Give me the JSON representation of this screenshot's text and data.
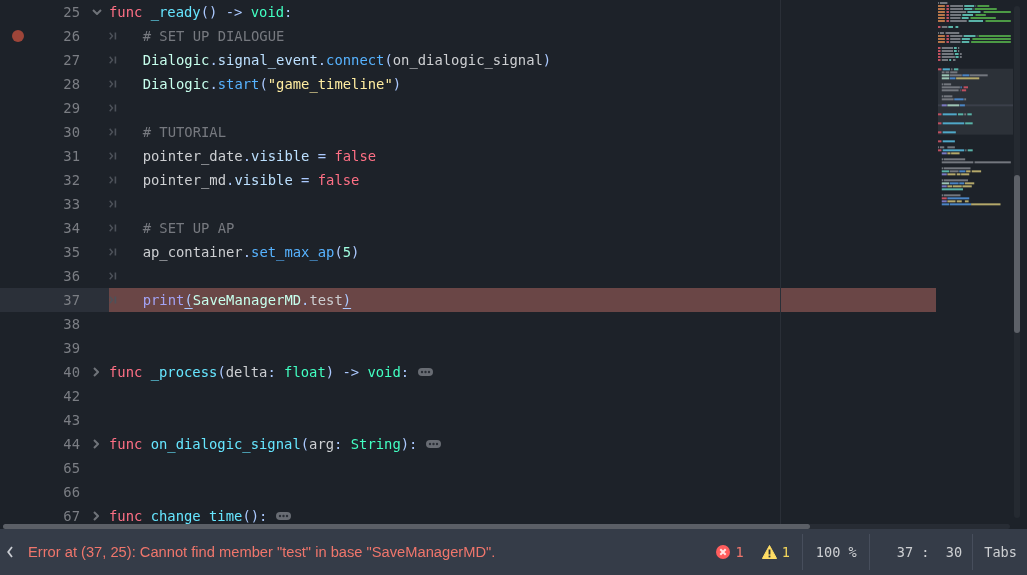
{
  "editor": {
    "lines": [
      {
        "number": "25",
        "folded": false,
        "breakpoint": false,
        "indented": false,
        "current": false,
        "error_highlight": false,
        "tokens": [
          {
            "kind": "keyword",
            "text": "func "
          },
          {
            "kind": "function_def",
            "text": "_ready"
          },
          {
            "kind": "symbol",
            "text": "() -> "
          },
          {
            "kind": "base_type",
            "text": "void"
          },
          {
            "kind": "symbol",
            "text": ":"
          }
        ]
      },
      {
        "number": "26",
        "breakpoint": true,
        "indented": true,
        "current": false,
        "error_highlight": false,
        "tokens": [
          {
            "kind": "comment",
            "text": "# SET UP DIALOGUE"
          }
        ]
      },
      {
        "number": "27",
        "breakpoint": false,
        "indented": true,
        "current": false,
        "error_highlight": false,
        "tokens": [
          {
            "kind": "user_type",
            "text": "Dialogic"
          },
          {
            "kind": "symbol",
            "text": "."
          },
          {
            "kind": "member",
            "text": "signal_event"
          },
          {
            "kind": "symbol",
            "text": "."
          },
          {
            "kind": "function",
            "text": "connect"
          },
          {
            "kind": "symbol",
            "text": "("
          },
          {
            "kind": "text",
            "text": "on_dialogic_signal"
          },
          {
            "kind": "symbol",
            "text": ")"
          }
        ]
      },
      {
        "number": "28",
        "breakpoint": false,
        "indented": true,
        "current": false,
        "error_highlight": false,
        "tokens": [
          {
            "kind": "user_type",
            "text": "Dialogic"
          },
          {
            "kind": "symbol",
            "text": "."
          },
          {
            "kind": "function",
            "text": "start"
          },
          {
            "kind": "symbol",
            "text": "("
          },
          {
            "kind": "string",
            "text": "\"game_timeline\""
          },
          {
            "kind": "symbol",
            "text": ")"
          }
        ]
      },
      {
        "number": "29",
        "breakpoint": false,
        "indented": true,
        "current": false,
        "error_highlight": false
      },
      {
        "number": "30",
        "breakpoint": false,
        "indented": true,
        "current": false,
        "error_highlight": false,
        "tokens": [
          {
            "kind": "comment",
            "text": "# TUTORIAL"
          }
        ]
      },
      {
        "number": "31",
        "breakpoint": false,
        "indented": true,
        "current": false,
        "error_highlight": false,
        "tokens": [
          {
            "kind": "text",
            "text": "pointer_date"
          },
          {
            "kind": "symbol",
            "text": "."
          },
          {
            "kind": "member",
            "text": "visible"
          },
          {
            "kind": "symbol",
            "text": " = "
          },
          {
            "kind": "keyword",
            "text": "false"
          }
        ]
      },
      {
        "number": "32",
        "breakpoint": false,
        "indented": true,
        "current": false,
        "error_highlight": false,
        "tokens": [
          {
            "kind": "text",
            "text": "pointer_md"
          },
          {
            "kind": "symbol",
            "text": "."
          },
          {
            "kind": "member",
            "text": "visible"
          },
          {
            "kind": "symbol",
            "text": " = "
          },
          {
            "kind": "keyword",
            "text": "false"
          }
        ]
      },
      {
        "number": "33",
        "breakpoint": false,
        "indented": true,
        "current": false,
        "error_highlight": false
      },
      {
        "number": "34",
        "breakpoint": false,
        "indented": true,
        "current": false,
        "error_highlight": false,
        "tokens": [
          {
            "kind": "comment",
            "text": "# SET UP AP"
          }
        ]
      },
      {
        "number": "35",
        "breakpoint": false,
        "indented": true,
        "current": false,
        "error_highlight": false,
        "tokens": [
          {
            "kind": "text",
            "text": "ap_container"
          },
          {
            "kind": "symbol",
            "text": "."
          },
          {
            "kind": "function",
            "text": "set_max_ap"
          },
          {
            "kind": "symbol",
            "text": "("
          },
          {
            "kind": "number",
            "text": "5"
          },
          {
            "kind": "symbol",
            "text": ")"
          }
        ]
      },
      {
        "number": "36",
        "breakpoint": false,
        "indented": true,
        "current": false,
        "error_highlight": false
      },
      {
        "number": "37",
        "breakpoint": false,
        "indented": true,
        "current": true,
        "error_highlight": true,
        "tokens": [
          {
            "kind": "global_function",
            "text": "print"
          },
          {
            "kind": "matched_bracket",
            "text": "("
          },
          {
            "kind": "user_type",
            "text": "SaveManagerMD"
          },
          {
            "kind": "symbol",
            "text": "."
          },
          {
            "kind": "text",
            "text": "test"
          },
          {
            "kind": "matched_bracket",
            "text": ")"
          }
        ]
      },
      {
        "number": "38",
        "breakpoint": false,
        "indented": false,
        "current": false,
        "error_highlight": false
      },
      {
        "number": "39",
        "breakpoint": false,
        "indented": false,
        "current": false,
        "error_highlight": false
      },
      {
        "number": "40",
        "folded": true,
        "breakpoint": false,
        "indented": false,
        "current": false,
        "error_highlight": false,
        "tokens": [
          {
            "kind": "keyword",
            "text": "func "
          },
          {
            "kind": "function_def",
            "text": "_process"
          },
          {
            "kind": "symbol",
            "text": "("
          },
          {
            "kind": "text",
            "text": "delta"
          },
          {
            "kind": "symbol",
            "text": ": "
          },
          {
            "kind": "base_type",
            "text": "float"
          },
          {
            "kind": "symbol",
            "text": ") -> "
          },
          {
            "kind": "base_type",
            "text": "void"
          },
          {
            "kind": "symbol",
            "text": ":"
          }
        ]
      },
      {
        "number": "42",
        "breakpoint": false,
        "indented": false,
        "current": false,
        "error_highlight": false
      },
      {
        "number": "43",
        "breakpoint": false,
        "indented": false,
        "current": false,
        "error_highlight": false
      },
      {
        "number": "44",
        "folded": true,
        "breakpoint": false,
        "indented": false,
        "current": false,
        "error_highlight": false,
        "tokens": [
          {
            "kind": "keyword",
            "text": "func "
          },
          {
            "kind": "function_def",
            "text": "on_dialogic_signal"
          },
          {
            "kind": "symbol",
            "text": "("
          },
          {
            "kind": "text",
            "text": "arg"
          },
          {
            "kind": "symbol",
            "text": ": "
          },
          {
            "kind": "base_type",
            "text": "String"
          },
          {
            "kind": "symbol",
            "text": "):"
          }
        ]
      },
      {
        "number": "65",
        "breakpoint": false,
        "indented": false,
        "current": false,
        "error_highlight": false
      },
      {
        "number": "66",
        "breakpoint": false,
        "indented": false,
        "current": false,
        "error_highlight": false
      },
      {
        "number": "67",
        "folded": true,
        "breakpoint": false,
        "indented": false,
        "current": false,
        "error_highlight": false,
        "tokens": [
          {
            "kind": "keyword",
            "text": "func "
          },
          {
            "kind": "function_def",
            "text": "change_time"
          },
          {
            "kind": "symbol",
            "text": "():"
          }
        ]
      }
    ]
  },
  "status_bar": {
    "message": "Error at (37, 25): Cannot find member \"test\" in base \"SaveManagerMD\".",
    "error": true,
    "error_count": "1",
    "warning_count": "1",
    "zoom": "100 %",
    "caret_position": "37 :  30",
    "indentation": "Tabs"
  }
}
